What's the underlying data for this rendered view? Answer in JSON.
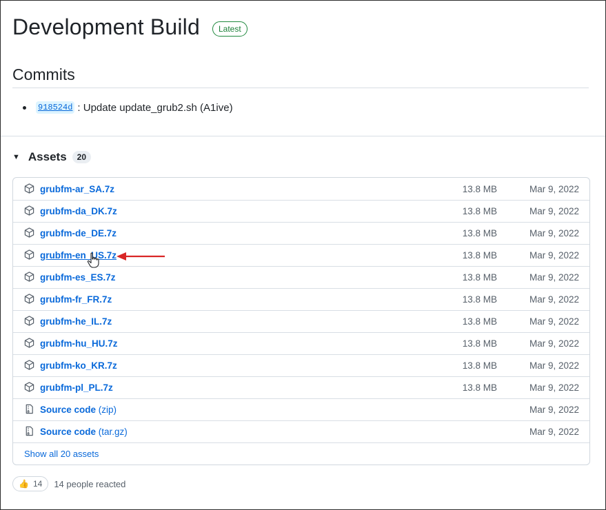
{
  "release": {
    "title": "Development Build",
    "badge": "Latest"
  },
  "commits": {
    "heading": "Commits",
    "items": [
      {
        "sha": "918524d",
        "message": ": Update update_grub2.sh (A1ive)"
      }
    ]
  },
  "assets": {
    "heading": "Assets",
    "count": "20",
    "items": [
      {
        "name": "grubfm-ar_SA.7z",
        "ext": "",
        "size": "13.8 MB",
        "date": "Mar 9, 2022",
        "icon": "package-icon"
      },
      {
        "name": "grubfm-da_DK.7z",
        "ext": "",
        "size": "13.8 MB",
        "date": "Mar 9, 2022",
        "icon": "package-icon"
      },
      {
        "name": "grubfm-de_DE.7z",
        "ext": "",
        "size": "13.8 MB",
        "date": "Mar 9, 2022",
        "icon": "package-icon"
      },
      {
        "name": "grubfm-en_US.7z",
        "ext": "",
        "size": "13.8 MB",
        "date": "Mar 9, 2022",
        "icon": "package-icon"
      },
      {
        "name": "grubfm-es_ES.7z",
        "ext": "",
        "size": "13.8 MB",
        "date": "Mar 9, 2022",
        "icon": "package-icon"
      },
      {
        "name": "grubfm-fr_FR.7z",
        "ext": "",
        "size": "13.8 MB",
        "date": "Mar 9, 2022",
        "icon": "package-icon"
      },
      {
        "name": "grubfm-he_IL.7z",
        "ext": "",
        "size": "13.8 MB",
        "date": "Mar 9, 2022",
        "icon": "package-icon"
      },
      {
        "name": "grubfm-hu_HU.7z",
        "ext": "",
        "size": "13.8 MB",
        "date": "Mar 9, 2022",
        "icon": "package-icon"
      },
      {
        "name": "grubfm-ko_KR.7z",
        "ext": "",
        "size": "13.8 MB",
        "date": "Mar 9, 2022",
        "icon": "package-icon"
      },
      {
        "name": "grubfm-pl_PL.7z",
        "ext": "",
        "size": "13.8 MB",
        "date": "Mar 9, 2022",
        "icon": "package-icon"
      },
      {
        "name": "Source code",
        "ext": " (zip)",
        "size": "",
        "date": "Mar 9, 2022",
        "icon": "file-zip-icon"
      },
      {
        "name": "Source code",
        "ext": " (tar.gz)",
        "size": "",
        "date": "Mar 9, 2022",
        "icon": "file-zip-icon"
      }
    ],
    "show_all": "Show all 20 assets"
  },
  "reactions": {
    "emoji": "👍",
    "count": "14",
    "summary": "14 people reacted"
  },
  "annotation": {
    "arrow_color": "#d92626",
    "highlighted_asset": "grubfm-en_US.7z"
  }
}
